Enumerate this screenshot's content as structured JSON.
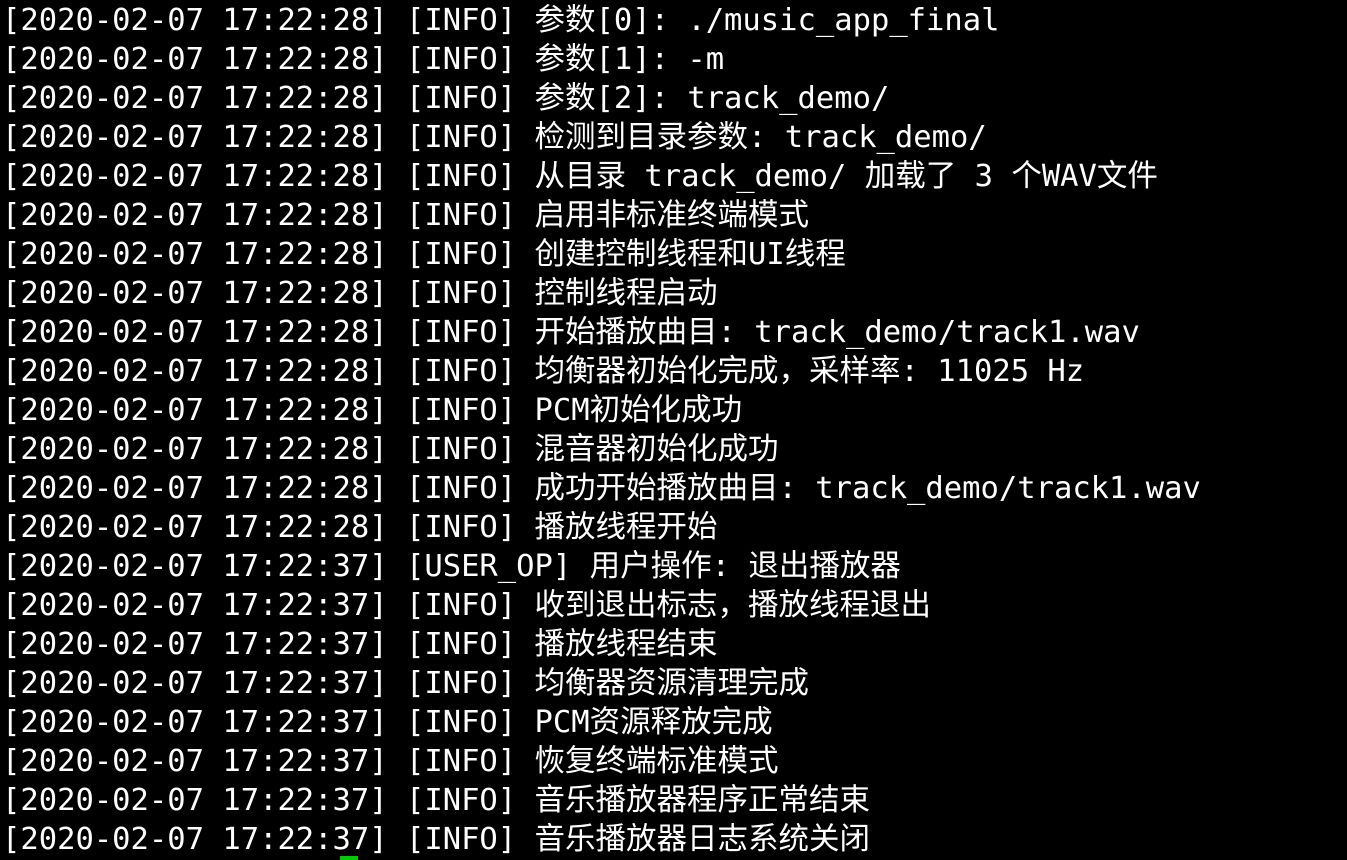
{
  "terminal": {
    "lines": [
      "[2020-02-07 17:22:28] [INFO] 参数[0]: ./music_app_final",
      "[2020-02-07 17:22:28] [INFO] 参数[1]: -m",
      "[2020-02-07 17:22:28] [INFO] 参数[2]: track_demo/",
      "[2020-02-07 17:22:28] [INFO] 检测到目录参数: track_demo/",
      "[2020-02-07 17:22:28] [INFO] 从目录 track_demo/ 加载了 3 个WAV文件",
      "[2020-02-07 17:22:28] [INFO] 启用非标准终端模式",
      "[2020-02-07 17:22:28] [INFO] 创建控制线程和UI线程",
      "[2020-02-07 17:22:28] [INFO] 控制线程启动",
      "[2020-02-07 17:22:28] [INFO] 开始播放曲目: track_demo/track1.wav",
      "[2020-02-07 17:22:28] [INFO] 均衡器初始化完成，采样率: 11025 Hz",
      "[2020-02-07 17:22:28] [INFO] PCM初始化成功",
      "[2020-02-07 17:22:28] [INFO] 混音器初始化成功",
      "[2020-02-07 17:22:28] [INFO] 成功开始播放曲目: track_demo/track1.wav",
      "[2020-02-07 17:22:28] [INFO] 播放线程开始",
      "[2020-02-07 17:22:37] [USER_OP] 用户操作: 退出播放器",
      "[2020-02-07 17:22:37] [INFO] 收到退出标志，播放线程退出",
      "[2020-02-07 17:22:37] [INFO] 播放线程结束",
      "[2020-02-07 17:22:37] [INFO] 均衡器资源清理完成",
      "[2020-02-07 17:22:37] [INFO] PCM资源释放完成",
      "[2020-02-07 17:22:37] [INFO] 恢复终端标准模式",
      "[2020-02-07 17:22:37] [INFO] 音乐播放器程序正常结束",
      "[2020-02-07 17:22:37] [INFO] 音乐播放器日志系统关闭"
    ]
  },
  "colors": {
    "background": "#000000",
    "text": "#ffffff",
    "cursor": "#00cc00"
  }
}
